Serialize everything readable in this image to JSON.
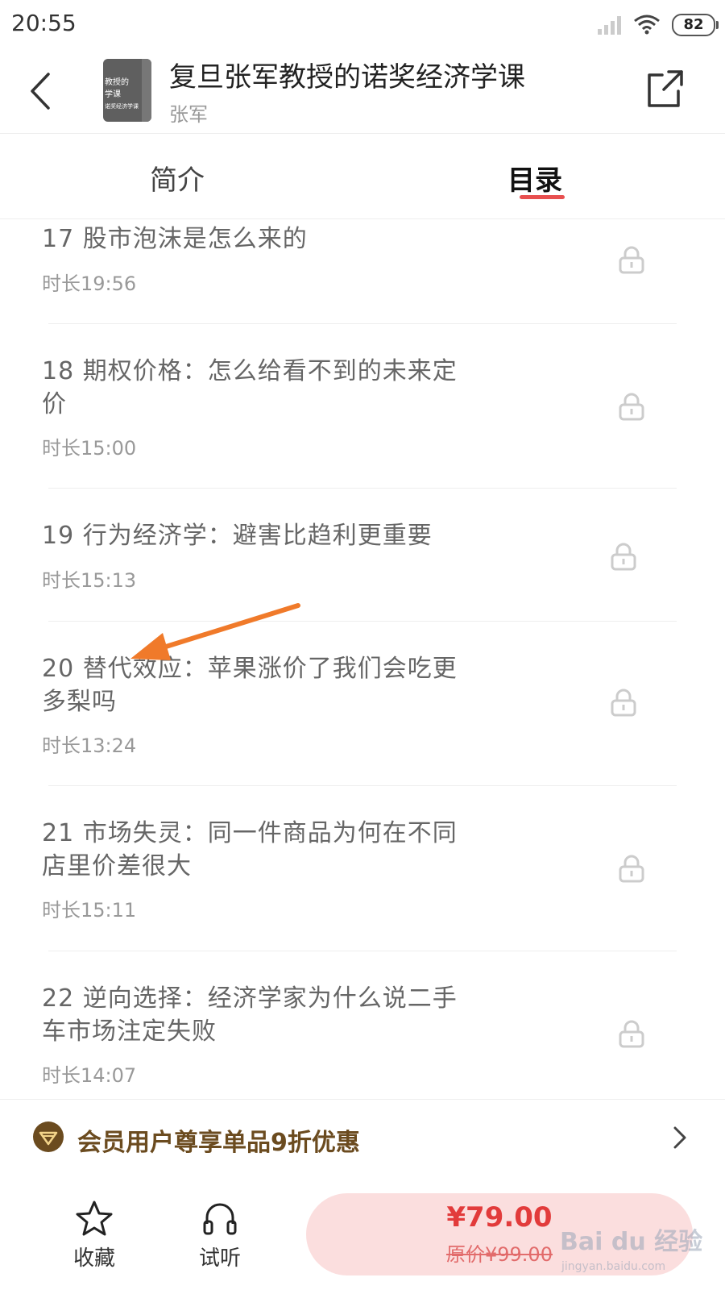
{
  "status_bar": {
    "time": "20:55",
    "battery": "82"
  },
  "header": {
    "title": "复旦张军教授的诺奖经济学课",
    "author": "张军",
    "cover_text_line1": "教授的",
    "cover_text_line2": "学课",
    "cover_text_line3": "诺奖经济学课"
  },
  "tabs": [
    {
      "label": "简介",
      "active": false
    },
    {
      "label": "目录",
      "active": true
    }
  ],
  "episodes": [
    {
      "title": "17 股市泡沫是怎么来的",
      "duration": "时长19:56",
      "locked": true
    },
    {
      "title": "18 期权价格：怎么给看不到的未来定价",
      "duration": "时长15:00",
      "locked": true
    },
    {
      "title": "19 行为经济学：避害比趋利更重要",
      "duration": "时长15:13",
      "locked": true
    },
    {
      "title": "20 替代效应：苹果涨价了我们会吃更多梨吗",
      "duration": "时长13:24",
      "locked": true
    },
    {
      "title": "21 市场失灵：同一件商品为何在不同店里价差很大",
      "duration": "时长15:11",
      "locked": true
    },
    {
      "title": "22 逆向选择：经济学家为什么说二手车市场注定失败",
      "duration": "时长14:07",
      "locked": true
    }
  ],
  "promo": {
    "text": "会员用户尊享单品9折优惠"
  },
  "bottom_bar": {
    "favorite_label": "收藏",
    "listen_label": "试听",
    "price": "¥79.00",
    "original_price": "原价¥99.00"
  },
  "watermark": {
    "main": "Bai du 经验",
    "sub": "jingyan.baidu.com"
  },
  "colors": {
    "accent": "#e84f4f",
    "annotation_arrow": "#f07a2a",
    "promo_text": "#6b4b1f"
  },
  "icons": [
    "back-icon",
    "share-icon",
    "lock-icon",
    "crown-icon",
    "chevron-right-icon",
    "star-icon",
    "headphones-icon"
  ]
}
